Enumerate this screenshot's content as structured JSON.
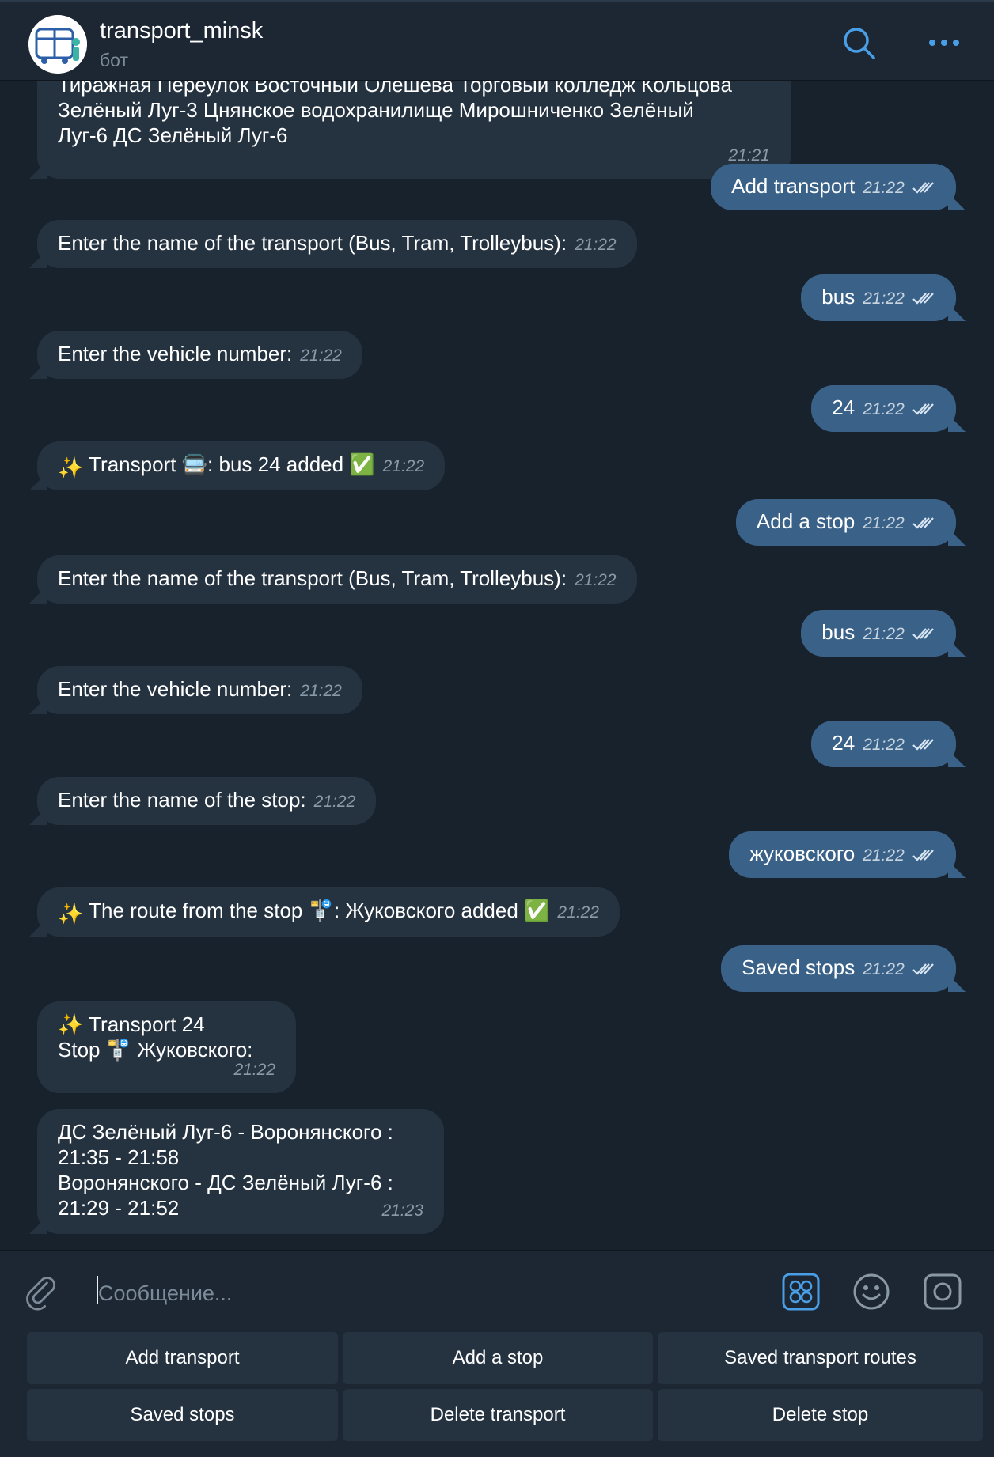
{
  "header": {
    "title": "transport_minsk",
    "subtitle": "бот"
  },
  "messages": [
    {
      "dir": "in",
      "lines": [
        "Тиражная Переулок Восточный Олешева Торговый колледж Кольцова",
        "Зелёный Луг-3 Цнянское водохранилище Мирошниченко Зелёный",
        "Луг-6 ДС Зелёный Луг-6"
      ],
      "time": "21:21"
    },
    {
      "dir": "out",
      "text": "Add transport",
      "time": "21:22"
    },
    {
      "dir": "in",
      "text": "Enter the name of the transport (Bus, Tram, Trolleybus):",
      "time": "21:22"
    },
    {
      "dir": "out",
      "text": "bus",
      "time": "21:22"
    },
    {
      "dir": "in",
      "text": "Enter the vehicle number:",
      "time": "21:22"
    },
    {
      "dir": "out",
      "text": "24",
      "time": "21:22"
    },
    {
      "dir": "in",
      "prefix": "✨",
      "text": "Transport 🚍: bus 24 added ✅",
      "time": "21:22"
    },
    {
      "dir": "out",
      "text": "Add a stop",
      "time": "21:22"
    },
    {
      "dir": "in",
      "text": "Enter the name of the transport (Bus, Tram, Trolleybus):",
      "time": "21:22"
    },
    {
      "dir": "out",
      "text": "bus",
      "time": "21:22"
    },
    {
      "dir": "in",
      "text": "Enter the vehicle number:",
      "time": "21:22"
    },
    {
      "dir": "out",
      "text": "24",
      "time": "21:22"
    },
    {
      "dir": "in",
      "text": "Enter the name of the stop:",
      "time": "21:22"
    },
    {
      "dir": "out",
      "text": "жуковского",
      "time": "21:22"
    },
    {
      "dir": "in",
      "prefix": "✨",
      "text": "The route from the stop 🚏: Жуковского added ✅",
      "time": "21:22"
    },
    {
      "dir": "out",
      "text": "Saved stops",
      "time": "21:22"
    },
    {
      "dir": "in",
      "lines": [
        "✨ Transport 24",
        "Stop 🚏 Жуковского:"
      ],
      "time": "21:22"
    },
    {
      "dir": "in",
      "lines": [
        "ДС Зелёный Луг-6 - Воронянского :",
        "21:35 - 21:58",
        "Воронянского - ДС Зелёный Луг-6 :",
        "21:29 - 21:52"
      ],
      "time": "21:23"
    }
  ],
  "composer": {
    "placeholder": "Сообщение..."
  },
  "keyboard": {
    "buttons": [
      "Add transport",
      "Add a stop",
      "Saved transport routes",
      "Saved stops",
      "Delete transport",
      "Delete stop"
    ]
  },
  "colors": {
    "background": "#18222d",
    "incoming_bubble": "#253341",
    "outgoing_bubble": "#3a6289",
    "accent": "#5aa0e8"
  },
  "icons": [
    "bus-avatar-icon",
    "search-icon",
    "more-icon",
    "double-check-icon",
    "attach-icon",
    "keyboard-icon",
    "emoji-icon",
    "camera-icon"
  ]
}
